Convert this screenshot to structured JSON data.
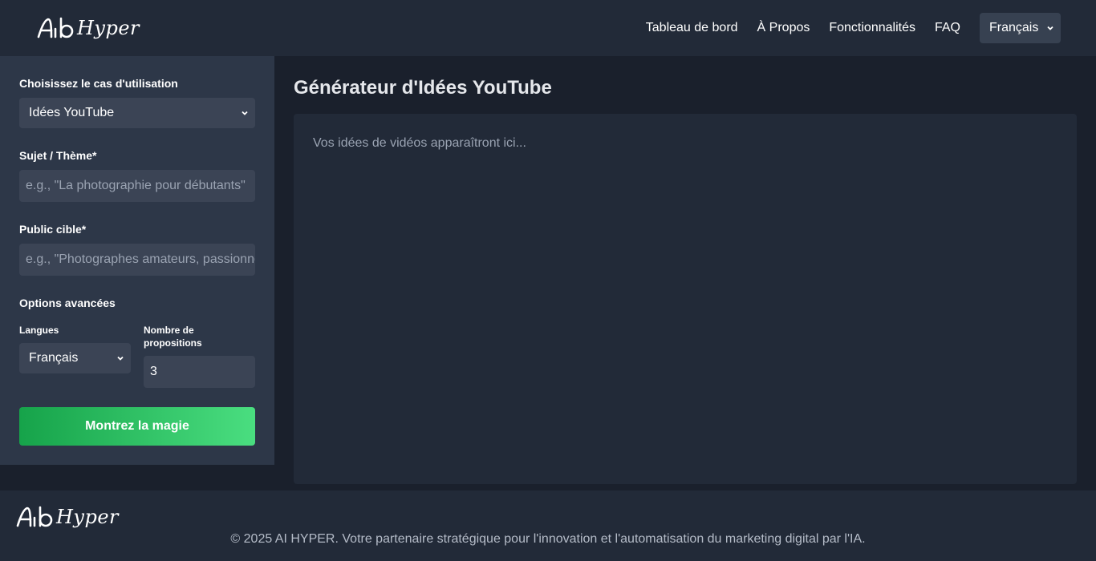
{
  "brand": {
    "logo_text": "Hyper"
  },
  "nav": {
    "links": [
      "Tableau de bord",
      "À Propos",
      "Fonctionnalités",
      "FAQ"
    ],
    "language": "Français"
  },
  "sidebar": {
    "use_case_label": "Choisissez le cas d'utilisation",
    "use_case_value": "Idées YouTube",
    "subject_label": "Sujet / Thème*",
    "subject_placeholder": "e.g., \"La photographie pour débutants\"",
    "audience_label": "Public cible*",
    "audience_placeholder": "e.g., \"Photographes amateurs, passionnés\"",
    "advanced_label": "Options avancées",
    "languages_label": "Langues",
    "languages_value": "Français",
    "count_label": "Nombre de propositions",
    "count_value": "3",
    "submit_label": "Montrez la magie"
  },
  "main": {
    "title": "Générateur d'Idées YouTube",
    "output_placeholder": "Vos idées de vidéos apparaîtront ici..."
  },
  "footer": {
    "copyright": "© 2025 AI HYPER. Votre partenaire stratégique pour l'innovation et l'automatisation du marketing digital par l'IA."
  },
  "colors": {
    "background": "#1a202c",
    "header": "#222a38",
    "sidebar": "#2d3748",
    "field": "#3b4455",
    "accent_start": "#16a34a",
    "accent_end": "#4ade80"
  }
}
